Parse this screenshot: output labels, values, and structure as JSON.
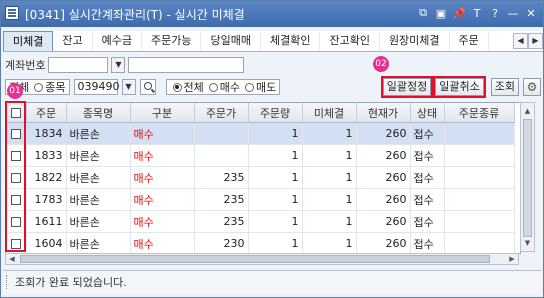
{
  "window": {
    "title": "[0341] 실시간계좌관리(T) - 실시간 미체결",
    "controls": [
      "⧉",
      "▣",
      "📌",
      "T",
      "?",
      "—",
      "✕"
    ]
  },
  "tabs": [
    "미체결",
    "잔고",
    "예수금",
    "주문가능",
    "당일매매",
    "체결확인",
    "잔고확인",
    "원장미체결",
    "주문"
  ],
  "active_tab": "미체결",
  "account": {
    "label": "계좌번호",
    "value": "",
    "name_value": ""
  },
  "filter": {
    "scope_options": [
      "전체",
      "종목"
    ],
    "scope_selected": "전체",
    "stock_code": "039490",
    "side_options": [
      "전체",
      "매수",
      "매도"
    ],
    "side_selected": "전체"
  },
  "buttons": {
    "bulk_modify": "일괄정정",
    "bulk_cancel": "일괄취소",
    "query": "조회"
  },
  "markers": {
    "m1": "01",
    "m2": "02"
  },
  "table": {
    "headers": [
      "주문",
      "종목명",
      "구분",
      "주문가",
      "주문량",
      "미체결",
      "현재가",
      "상태",
      "주문종류"
    ],
    "rows": [
      {
        "order": "1834",
        "name": "바른손",
        "side": "매수",
        "price": "",
        "qty": "1",
        "unfilled": "1",
        "current": "260",
        "status": "접수",
        "type": ""
      },
      {
        "order": "1833",
        "name": "바른손",
        "side": "매수",
        "price": "",
        "qty": "1",
        "unfilled": "1",
        "current": "260",
        "status": "접수",
        "type": ""
      },
      {
        "order": "1822",
        "name": "바른손",
        "side": "매수",
        "price": "235",
        "qty": "1",
        "unfilled": "1",
        "current": "260",
        "status": "접수",
        "type": ""
      },
      {
        "order": "1783",
        "name": "바른손",
        "side": "매수",
        "price": "235",
        "qty": "1",
        "unfilled": "1",
        "current": "260",
        "status": "접수",
        "type": ""
      },
      {
        "order": "1611",
        "name": "바른손",
        "side": "매수",
        "price": "235",
        "qty": "1",
        "unfilled": "1",
        "current": "260",
        "status": "접수",
        "type": ""
      },
      {
        "order": "1604",
        "name": "바른손",
        "side": "매수",
        "price": "230",
        "qty": "1",
        "unfilled": "1",
        "current": "260",
        "status": "접수",
        "type": ""
      }
    ]
  },
  "status_bar": {
    "message": "조회가 완료 되었습니다."
  },
  "colors": {
    "titlebar": "#4a76b8",
    "sell_text": "#d11111",
    "highlight": "#e0102a",
    "marker": "#e8308f",
    "selected_row": "#d3e0f3"
  }
}
